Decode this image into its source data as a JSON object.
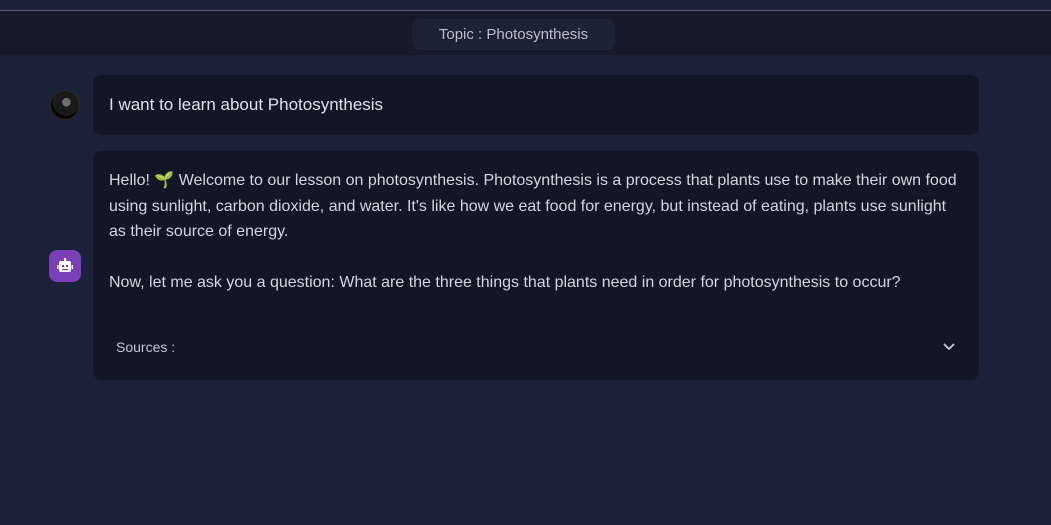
{
  "header": {
    "topic": "Topic : Photosynthesis"
  },
  "messages": {
    "user": {
      "text": "I want to learn about Photosynthesis"
    },
    "bot": {
      "paragraph1": "Hello! 🌱 Welcome to our lesson on photosynthesis. Photosynthesis is a process that plants use to make their own food using sunlight, carbon dioxide, and water. It's like how we eat food for energy, but instead of eating, plants use sunlight as their source of energy.",
      "paragraph2": "Now, let me ask you a question: What are the three things that plants need in order for photosynthesis to occur?",
      "sources_label": "Sources :"
    }
  },
  "icons": {
    "user_avatar": "user-avatar",
    "bot_avatar": "robot-icon",
    "expand": "chevron-down-icon"
  },
  "colors": {
    "background": "#1b2138",
    "header": "#161b2c",
    "bubble": "#121728",
    "bot_accent": "#7b3fb7"
  }
}
